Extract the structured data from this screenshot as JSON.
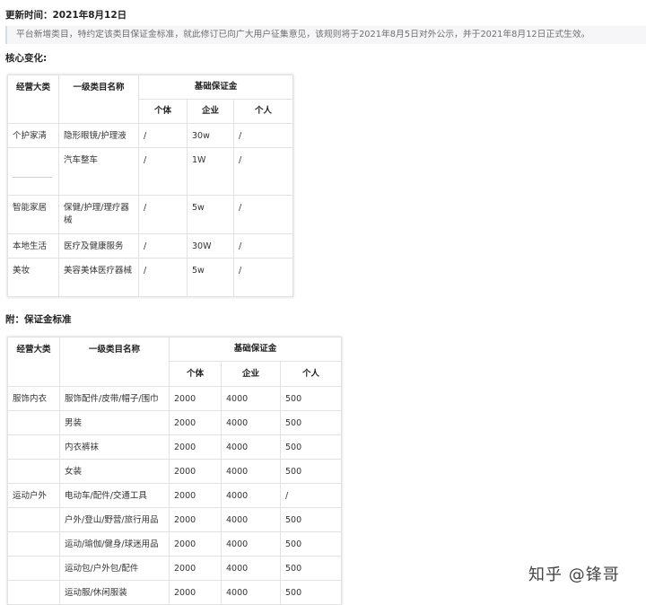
{
  "update": {
    "label": "更新时间：",
    "date": "2021年8月12日"
  },
  "notice": "平台新增类目，特约定该类目保证金标准，就此修订已向广大用户征集意见，该规则将于2021年8月5日对外公示，并于2021年8月12日正式生效。",
  "section_changes": "核心变化:",
  "section_standard": "附：保证金标准",
  "headers": {
    "category": "经营大类",
    "level1": "一级类目名称",
    "deposit": "基础保证金",
    "individual": "个体",
    "enterprise": "企业",
    "personal": "个人"
  },
  "changes_rows": [
    {
      "cat": "个护家清",
      "name": "隐形眼镜/护理液",
      "ind": "/",
      "ent": "30w",
      "per": "/"
    },
    {
      "cat": "",
      "name": "汽车整车",
      "ind": "/",
      "ent": "1W",
      "per": "/"
    },
    {
      "cat": "智能家居",
      "name": "保健/护理/理疗器械",
      "ind": "/",
      "ent": "5w",
      "per": "/"
    },
    {
      "cat": "本地生活",
      "name": "医疗及健康服务",
      "ind": "/",
      "ent": "30W",
      "per": "/"
    },
    {
      "cat": "美妆",
      "name": "美容美体医疗器械",
      "ind": "/",
      "ent": "5w",
      "per": "/"
    }
  ],
  "standard_rows": [
    {
      "cat": "服饰内衣",
      "name": "服饰配件/皮带/帽子/围巾",
      "ind": "2000",
      "ent": "4000",
      "per": "500"
    },
    {
      "cat": "",
      "name": "男装",
      "ind": "2000",
      "ent": "4000",
      "per": "500"
    },
    {
      "cat": "",
      "name": "内衣裤袜",
      "ind": "2000",
      "ent": "4000",
      "per": "500"
    },
    {
      "cat": "",
      "name": "女装",
      "ind": "2000",
      "ent": "4000",
      "per": "500"
    },
    {
      "cat": "运动户外",
      "name": "电动车/配件/交通工具",
      "ind": "2000",
      "ent": "4000",
      "per": "/"
    },
    {
      "cat": "",
      "name": "户外/登山/野营/旅行用品",
      "ind": "2000",
      "ent": "4000",
      "per": "500"
    },
    {
      "cat": "",
      "name": "运动/瑜伽/健身/球迷用品",
      "ind": "2000",
      "ent": "4000",
      "per": "500"
    },
    {
      "cat": "",
      "name": "运动包/户外包/配件",
      "ind": "2000",
      "ent": "4000",
      "per": "500"
    },
    {
      "cat": "",
      "name": "运动服/休闲服装",
      "ind": "2000",
      "ent": "4000",
      "per": "500"
    }
  ],
  "watermark": "知乎 @锋哥"
}
